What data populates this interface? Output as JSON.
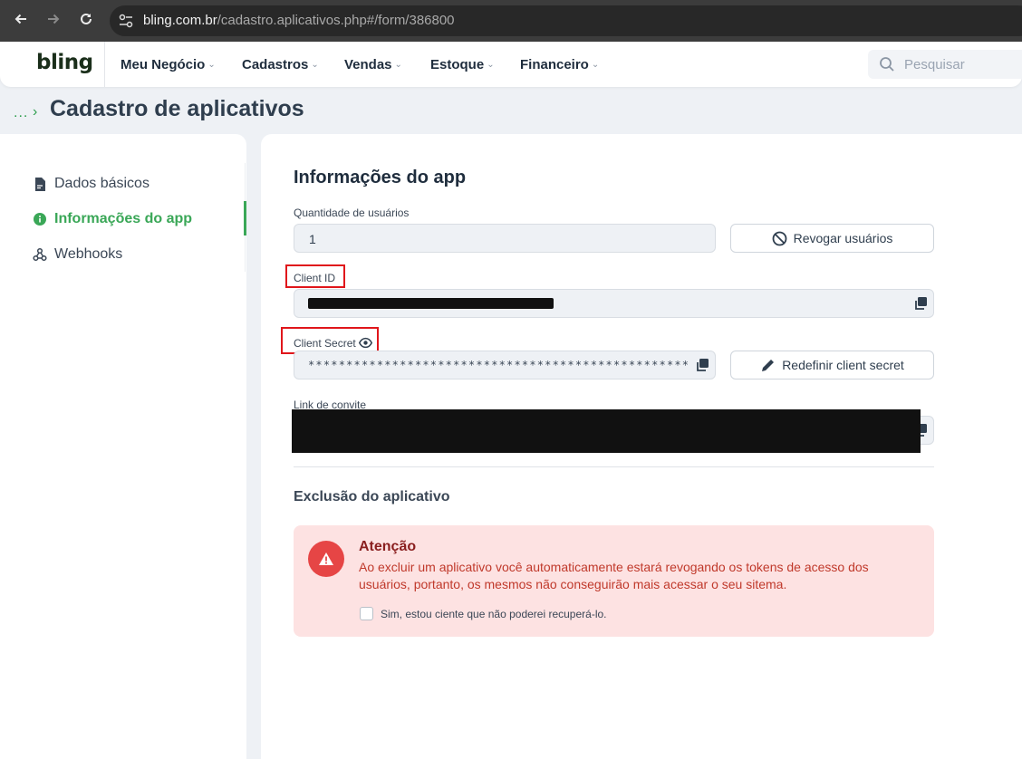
{
  "browser": {
    "url_host": "bling.com.br",
    "url_path": "/cadastro.aplicativos.php#/form/386800"
  },
  "header": {
    "logo": "bling",
    "menu": [
      {
        "label": "Meu Negócio"
      },
      {
        "label": "Cadastros"
      },
      {
        "label": "Vendas"
      },
      {
        "label": "Estoque"
      },
      {
        "label": "Financeiro"
      }
    ],
    "search_placeholder": "Pesquisar"
  },
  "breadcrumb": {
    "ellipsis": "...",
    "separator": "›"
  },
  "page_title": "Cadastro de aplicativos",
  "sidebar": {
    "items": [
      {
        "label": "Dados básicos",
        "icon": "document-icon",
        "active": false
      },
      {
        "label": "Informações do app",
        "icon": "info-icon",
        "active": true
      },
      {
        "label": "Webhooks",
        "icon": "webhook-icon",
        "active": false
      }
    ]
  },
  "main": {
    "section_title": "Informações do app",
    "users_label": "Quantidade de usuários",
    "users_value": "1",
    "revoke_button": "Revogar usuários",
    "client_id_label": "Client ID",
    "client_secret_label": "Client Secret",
    "client_secret_mask": "**************************************************",
    "reset_secret_button": "Redefinir client secret",
    "invite_link_label": "Link de convite",
    "deletion_title": "Exclusão do aplicativo",
    "alert": {
      "title": "Atenção",
      "message": "Ao excluir um aplicativo você automaticamente estará revogando os tokens de acesso dos usuários, portanto, os mesmos não conseguirão mais acessar o seu sitema.",
      "checkbox_label": "Sim, estou ciente que não poderei recuperá-lo.",
      "checked": false
    }
  },
  "colors": {
    "brand_green": "#3aa757",
    "alert_bg": "#fde2e2",
    "alert_red": "#e64545",
    "highlight_red": "#e0161b"
  }
}
